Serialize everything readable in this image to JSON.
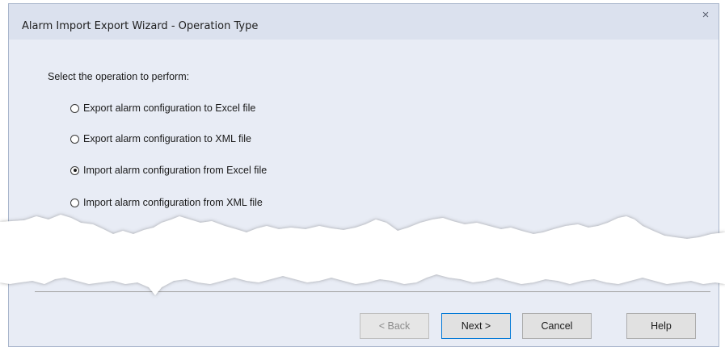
{
  "window": {
    "title": "Alarm Import Export Wizard - Operation Type",
    "close_glyph": "×",
    "close_icon": "close-icon"
  },
  "main": {
    "prompt": "Select the operation to perform:",
    "options": [
      {
        "label": "Export alarm configuration to Excel file",
        "checked": false
      },
      {
        "label": "Export alarm configuration to XML file",
        "checked": false
      },
      {
        "label": "Import alarm configuration from Excel file",
        "checked": true
      },
      {
        "label": "Import alarm configuration from XML file",
        "checked": false
      }
    ]
  },
  "buttons": {
    "back": "< Back",
    "next": "Next >",
    "cancel": "Cancel",
    "help": "Help"
  },
  "colors": {
    "dialog_bg": "#e8ecf5",
    "title_bg": "#dbe1ee",
    "default_button_border": "#0078d7"
  }
}
